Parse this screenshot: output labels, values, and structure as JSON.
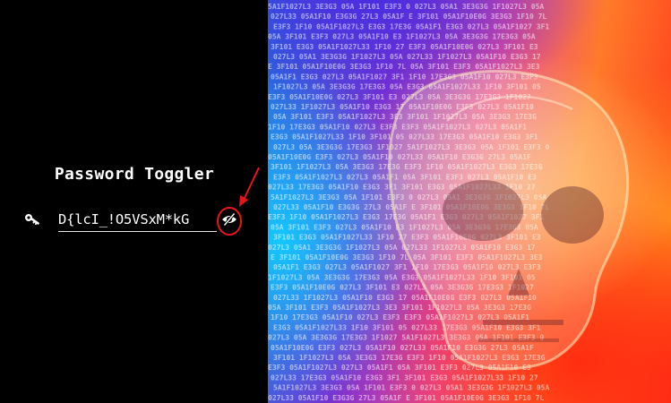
{
  "title": "Password Toggler",
  "password": {
    "value": "D{lcI_!O5VSxM*kG",
    "placeholder": ""
  },
  "icons": {
    "lock": "key-icon",
    "toggle": "eye-slash-icon"
  },
  "colors": {
    "annotation": "#e8141c",
    "background": "#000000",
    "text": "#ffffff"
  },
  "art": {
    "code_rows": [
      "5A1F1027L3 3E3G3 05A 1F101 E3F3 0",
      "027L33 05A1F10 E3G3G 27L3 05A1F",
      "E3F3 1F10 05A1F1027L3 E3G3 17E3G",
      "05A 3F101 E3F3 027L3 05A1F10 E3",
      "3F101 E3G3 05A1F1027L33 1F10 27",
      "027L3 05A1 3E3G3G 1F1027L3 05A",
      "E 3F101 05A1F10E0G 3E3G3 1F10 7L",
      "05A1F1 E3G3 027L3 05A1F1027 3F1",
      "1F1027L3 05A 3E3G3G 17E3G3 05A",
      "E3F3 05A1F10E0G 027L3 3F101 E3",
      "027L33 1F1027L3 05A1F10 E3G3 17",
      "05A 3F101 E3F3 05A1F1027L3 3E3",
      "1F10 17E3G3 05A1F10 027L3 E3F3",
      "E3G3 05A1F1027L33 1F10 3F101 05",
      "027L3 05A 3E3G3G 17E3G3 1F1027",
      "05A1F10E0G E3F3 027L3 05A1F10",
      "3F101 1F1027L3 05A 3E3G3 17E3G",
      "E3F3 05A1F1027L3 027L3 05A1F1",
      "027L33 17E3G3 05A1F10 E3G3 3F1"
    ]
  }
}
